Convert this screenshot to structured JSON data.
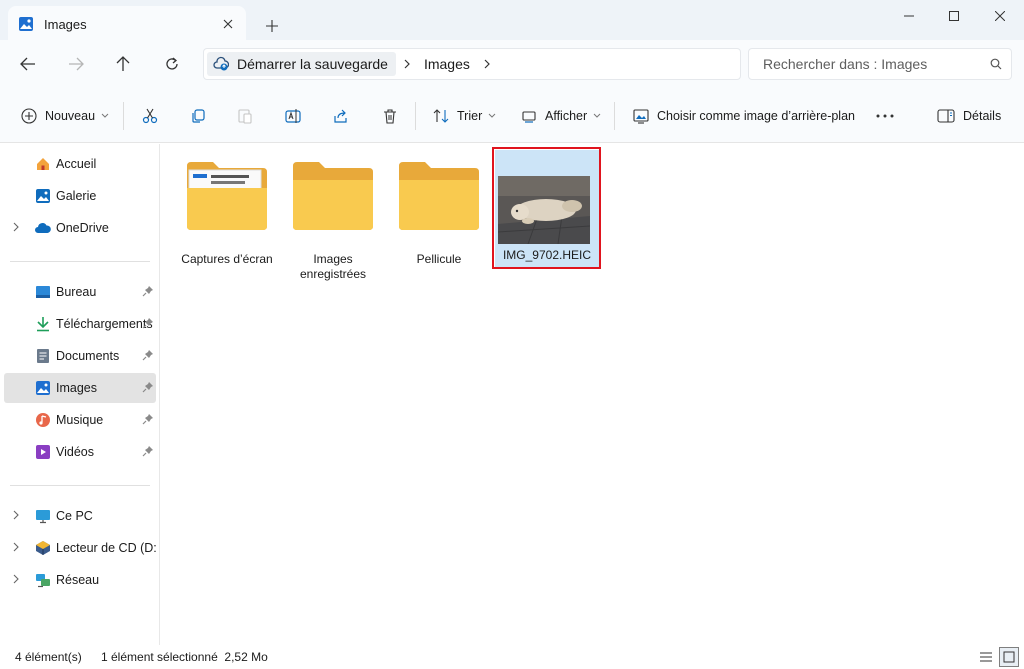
{
  "window": {
    "tab_title": "Images",
    "tab_icon": "images-folder-icon",
    "close_tab_icon": "close-icon",
    "new_tab_icon": "plus-icon",
    "controls": [
      "minimize-icon",
      "maximize-icon",
      "close-window-icon"
    ]
  },
  "nav": {
    "back_icon": "back-arrow-icon",
    "forward_icon": "forward-arrow-icon",
    "up_icon": "up-arrow-icon",
    "refresh_icon": "refresh-icon",
    "breadcrumb_root": "Démarrer la sauvegarde",
    "breadcrumb_current": "Images",
    "search_placeholder": "Rechercher dans : Images"
  },
  "toolbar": {
    "new_label": "Nouveau",
    "sort_label": "Trier",
    "view_label": "Afficher",
    "wallpaper_label": "Choisir comme image d’arrière-plan",
    "details_label": "Détails"
  },
  "sidebar": {
    "top": [
      {
        "label": "Accueil",
        "icon": "home-icon",
        "expandable": false
      },
      {
        "label": "Galerie",
        "icon": "gallery-icon",
        "expandable": false
      },
      {
        "label": "OneDrive",
        "icon": "onedrive-cloud-icon",
        "expandable": true
      }
    ],
    "quick": [
      {
        "label": "Bureau",
        "icon": "desktop-icon"
      },
      {
        "label": "Téléchargements",
        "icon": "download-icon"
      },
      {
        "label": "Documents",
        "icon": "documents-icon"
      },
      {
        "label": "Images",
        "icon": "images-icon",
        "selected": true
      },
      {
        "label": "Musique",
        "icon": "music-icon"
      },
      {
        "label": "Vidéos",
        "icon": "videos-icon"
      }
    ],
    "devices": [
      {
        "label": "Ce PC",
        "icon": "computer-icon"
      },
      {
        "label": "Lecteur de CD (D:) V",
        "icon": "cd-drive-icon"
      },
      {
        "label": "Réseau",
        "icon": "network-icon"
      }
    ]
  },
  "files": [
    {
      "name": "Captures d’écran",
      "type": "folder-with-preview"
    },
    {
      "name": "Images enregistrées",
      "type": "folder"
    },
    {
      "name": "Pellicule",
      "type": "folder"
    },
    {
      "name": "IMG_9702.HEIC",
      "type": "image",
      "selected": true
    }
  ],
  "status": {
    "count": "4 élément(s)",
    "selection": "1 élément sélectionné  2,52 Mo"
  },
  "colors": {
    "accent": "#0067c0",
    "folder": "#f8c84a",
    "selection": "#cce4f7",
    "highlight_border": "#e0141e"
  }
}
